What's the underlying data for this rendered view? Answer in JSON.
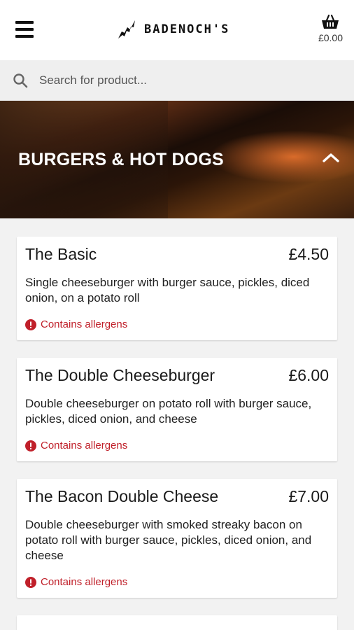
{
  "header": {
    "brand_name": "BADENOCH'S",
    "basket_total": "£0.00"
  },
  "search": {
    "placeholder": "Search for product..."
  },
  "category": {
    "title": "BURGERS & HOT DOGS"
  },
  "products": [
    {
      "name": "The Basic",
      "price": "£4.50",
      "description": "Single cheeseburger with burger sauce, pickles, diced onion, on a potato roll",
      "allergen_text": "Contains allergens"
    },
    {
      "name": "The Double Cheeseburger",
      "price": "£6.00",
      "description": "Double cheeseburger on potato roll with burger sauce, pickles, diced onion, and cheese",
      "allergen_text": "Contains allergens"
    },
    {
      "name": "The Bacon Double Cheese",
      "price": "£7.00",
      "description": "Double cheeseburger with smoked streaky bacon on potato roll with burger sauce, pickles, diced onion, and cheese",
      "allergen_text": "Contains allergens"
    }
  ],
  "colors": {
    "allergen": "#c0202a",
    "background": "#f2f2f2",
    "header": "#ffffff"
  },
  "icons": {
    "menu": "hamburger-menu-icon",
    "brand": "logo-icon",
    "basket": "basket-icon",
    "search": "search-icon",
    "collapse": "chevron-up-icon",
    "allergen": "alert-circle-icon"
  }
}
